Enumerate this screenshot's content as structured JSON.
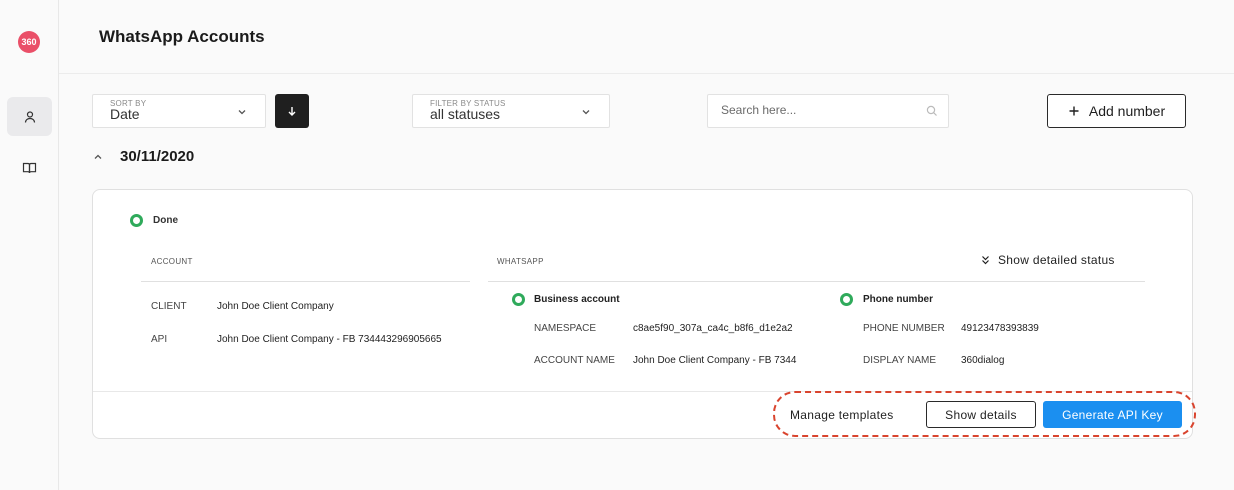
{
  "app": {
    "logo_text": "360",
    "title": "WhatsApp Accounts"
  },
  "sidebar": {
    "items": [
      {
        "icon": "user-icon",
        "active": true
      },
      {
        "icon": "book-icon",
        "active": false
      }
    ]
  },
  "toolbar": {
    "sort": {
      "label": "SORT BY",
      "value": "Date"
    },
    "filter": {
      "label": "FILTER BY STATUS",
      "value": "all statuses"
    },
    "search": {
      "placeholder": "Search here..."
    },
    "add_label": "Add number"
  },
  "group": {
    "date": "30/11/2020"
  },
  "card": {
    "status": "Done",
    "account": {
      "header": "ACCOUNT",
      "rows": [
        {
          "key": "CLIENT",
          "value": "John Doe Client Company"
        },
        {
          "key": "API",
          "value": "John Doe Client Company - FB 734443296905665"
        }
      ]
    },
    "whatsapp": {
      "header": "WHATSAPP",
      "show_status_label": "Show detailed status",
      "business": {
        "title": "Business account",
        "rows": [
          {
            "key": "NAMESPACE",
            "value": "c8ae5f90_307a_ca4c_b8f6_d1e2a2"
          },
          {
            "key": "ACCOUNT NAME",
            "value": "John Doe Client Company - FB 7344"
          }
        ]
      },
      "phone": {
        "title": "Phone number",
        "rows": [
          {
            "key": "PHONE NUMBER",
            "value": "49123478393839"
          },
          {
            "key": "DISPLAY NAME",
            "value": "360dialog"
          }
        ]
      }
    },
    "actions": {
      "manage_templates": "Manage templates",
      "show_details": "Show details",
      "generate_api_key": "Generate API Key"
    }
  },
  "colors": {
    "accent": "#1b8ff0",
    "status_ok": "#2faa5b",
    "logo": "#ea4f68",
    "highlight": "#d9442e"
  }
}
